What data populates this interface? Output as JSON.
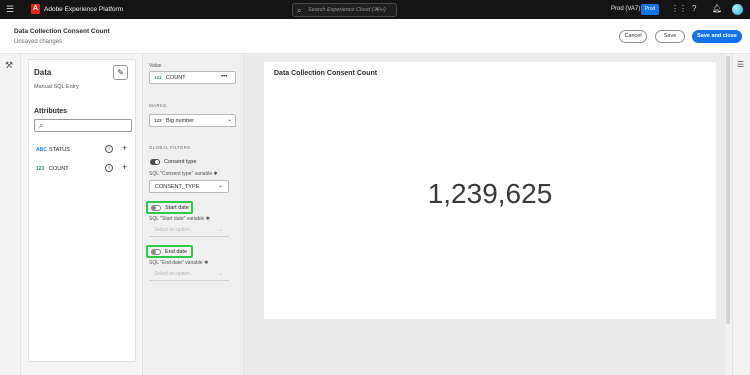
{
  "topbar": {
    "app_name": "Adobe Experience Platform",
    "search_placeholder": "Search Experience Cloud (⌘+/)",
    "org": "Prod (VA7)",
    "sandbox_badge": "Prod"
  },
  "header": {
    "title": "Data Collection Consent Count",
    "subtitle": "Unsaved changes",
    "cancel_label": "Cancel",
    "save_label": "Save",
    "save_close_label": "Save and close"
  },
  "data_panel": {
    "heading": "Data",
    "source": "Manual SQL Entry",
    "attributes_heading": "Attributes",
    "search_placeholder": "",
    "attributes": [
      {
        "type": "ABC",
        "name": "STATUS",
        "type_color": "#2680eb"
      },
      {
        "type": "123",
        "name": "COUNT",
        "type_color": "#2d9d78"
      }
    ]
  },
  "properties": {
    "value_label": "Value",
    "value_type": "123",
    "value_name": "COUNT",
    "marks_label": "MARKS",
    "marks_type": "123",
    "marks_value": "Big number",
    "global_filters_label": "GLOBAL FILTERS",
    "filters": [
      {
        "name": "Consent type",
        "enabled": true,
        "variable_label": "SQL \"Consent type\" variable",
        "selected": "CONSENT_TYPE",
        "placeholder": ""
      },
      {
        "name": "Start date",
        "enabled": false,
        "variable_label": "SQL \"Start date\" variable",
        "selected": "",
        "placeholder": "Select an option..."
      },
      {
        "name": "End date",
        "enabled": false,
        "variable_label": "SQL \"End date\" variable",
        "selected": "",
        "placeholder": "Select an option..."
      }
    ]
  },
  "chart": {
    "title": "Data Collection Consent Count",
    "big_number": "1,239,625"
  },
  "colors": {
    "accent": "#1473e6",
    "highlight": "#2fca4a",
    "topbar": "#141414"
  }
}
